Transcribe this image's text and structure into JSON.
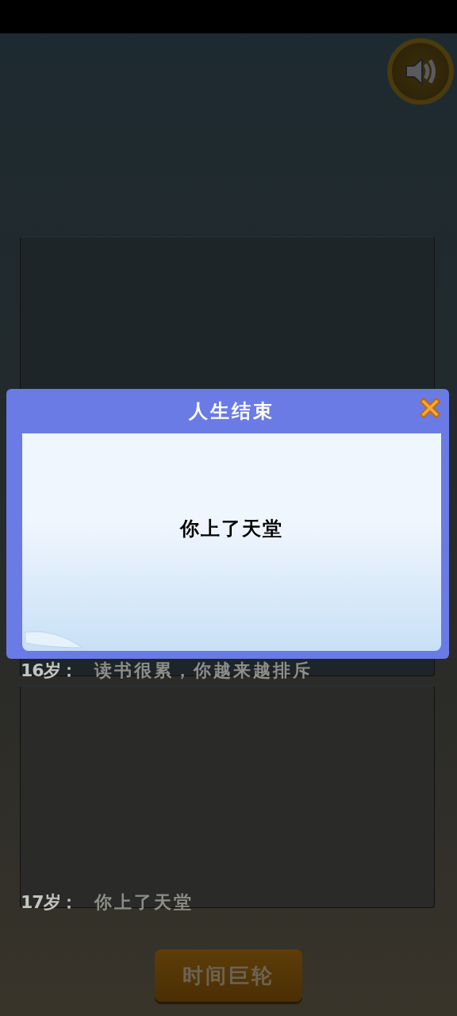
{
  "log": [
    {
      "age": "16岁：",
      "event": "读书很累，你越来越排斥"
    },
    {
      "age": "17岁：",
      "event": "你上了天堂"
    }
  ],
  "main_button": "时间巨轮",
  "dialog": {
    "title": "人生结束",
    "message": "你上了天堂"
  }
}
